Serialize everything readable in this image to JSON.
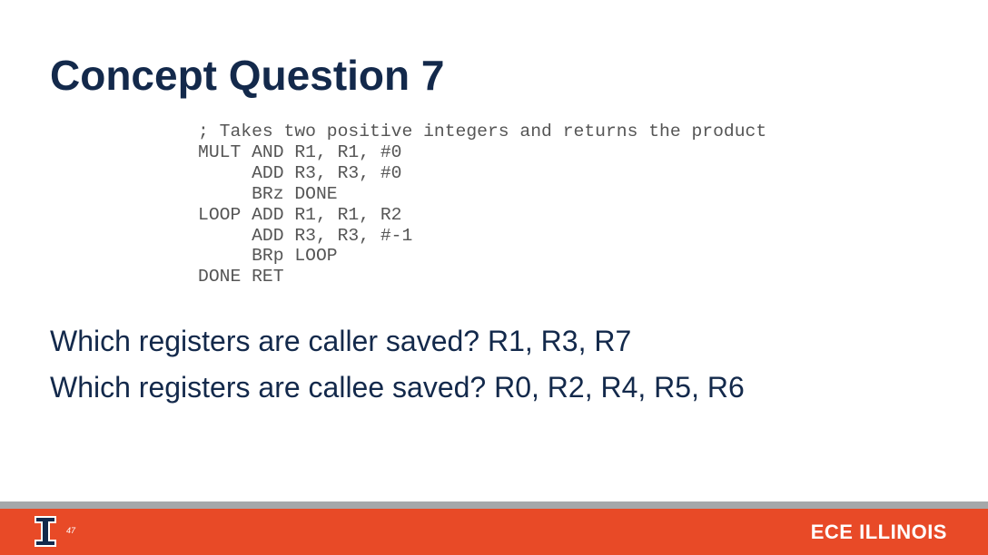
{
  "slide": {
    "title": "Concept Question 7",
    "code": "; Takes two positive integers and returns the product\nMULT AND R1, R1, #0\n     ADD R3, R3, #0\n     BRz DONE\nLOOP ADD R1, R1, R2\n     ADD R3, R3, #-1\n     BRp LOOP\nDONE RET",
    "questions": [
      "Which registers are caller saved? R1, R3, R7",
      "Which registers are callee saved? R0, R2, R4, R5, R6"
    ]
  },
  "footer": {
    "page_number": "47",
    "brand": "ECE ILLINOIS",
    "logo": "illinois-block-i",
    "colors": {
      "orange": "#e84a27",
      "navy": "#13294b",
      "gray": "#a5a8aa"
    }
  }
}
